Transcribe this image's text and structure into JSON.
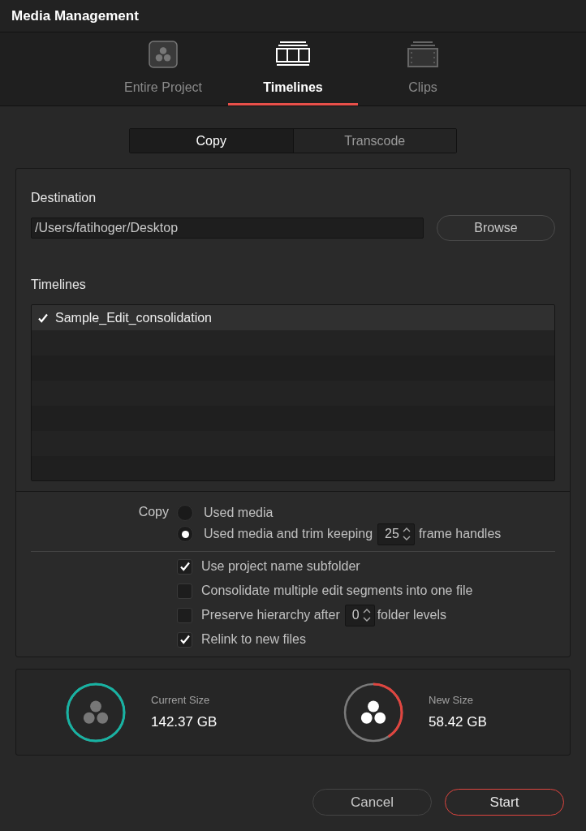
{
  "window": {
    "title": "Media Management"
  },
  "tabs": [
    {
      "label": "Entire Project",
      "kind": "project",
      "selected": false
    },
    {
      "label": "Timelines",
      "kind": "timelines",
      "selected": true
    },
    {
      "label": "Clips",
      "kind": "clips",
      "selected": false
    }
  ],
  "mode_switch": [
    {
      "label": "Copy",
      "selected": true
    },
    {
      "label": "Transcode",
      "selected": false
    }
  ],
  "destination": {
    "label": "Destination",
    "value": "/Users/fatihoger/Desktop",
    "button": "Browse"
  },
  "timelines": {
    "label": "Timelines",
    "items": [
      {
        "label": "Sample_Edit_consolidation",
        "checked": true,
        "selected": true
      }
    ]
  },
  "copy_options": {
    "label": "Copy",
    "choices": [
      {
        "label": "Used media",
        "selected": false
      },
      {
        "label": "Used media and trim keeping",
        "selected": true,
        "spinner": "25",
        "suffix": "frame handles"
      }
    ]
  },
  "options": [
    {
      "label": "Use project name subfolder",
      "checked": true
    },
    {
      "label": "Consolidate multiple edit segments into one file",
      "checked": false
    },
    {
      "label": "Preserve hierarchy after",
      "checked": false,
      "spinner": "0",
      "suffix": "folder levels"
    },
    {
      "label": "Relink to new files",
      "checked": true
    }
  ],
  "sizes": [
    {
      "kind": "current",
      "label": "Current Size",
      "value": "142.37 GB",
      "level": 1
    },
    {
      "kind": "new",
      "label": "New Size",
      "value": "58.42 GB",
      "level": 0.41
    }
  ],
  "buttons": [
    {
      "label": "Cancel",
      "kind": "secondary"
    },
    {
      "label": "Start",
      "kind": "primary"
    }
  ]
}
